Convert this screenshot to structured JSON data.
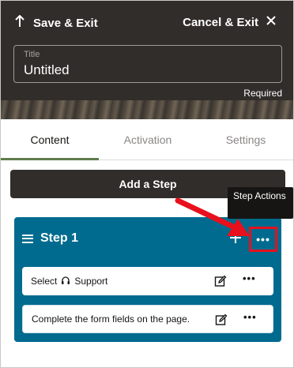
{
  "header": {
    "save_exit": "Save & Exit",
    "cancel_exit": "Cancel & Exit",
    "title_label": "Title",
    "title_value": "Untitled",
    "required": "Required"
  },
  "tabs": [
    {
      "label": "Content",
      "active": true
    },
    {
      "label": "Activation",
      "active": false
    },
    {
      "label": "Settings",
      "active": false
    }
  ],
  "add_step_label": "Add a Step",
  "tooltip": "Step Actions",
  "step": {
    "title": "Step 1",
    "cards": [
      {
        "text_before": "Select",
        "text_after": "Support",
        "icon": "headset-icon"
      },
      {
        "text": "Complete the form fields on the page."
      }
    ]
  },
  "colors": {
    "header_bg": "#312d2a",
    "step_bg": "#006b8f",
    "highlight": "#e8101c",
    "active_tab": "#5f7d4f"
  }
}
